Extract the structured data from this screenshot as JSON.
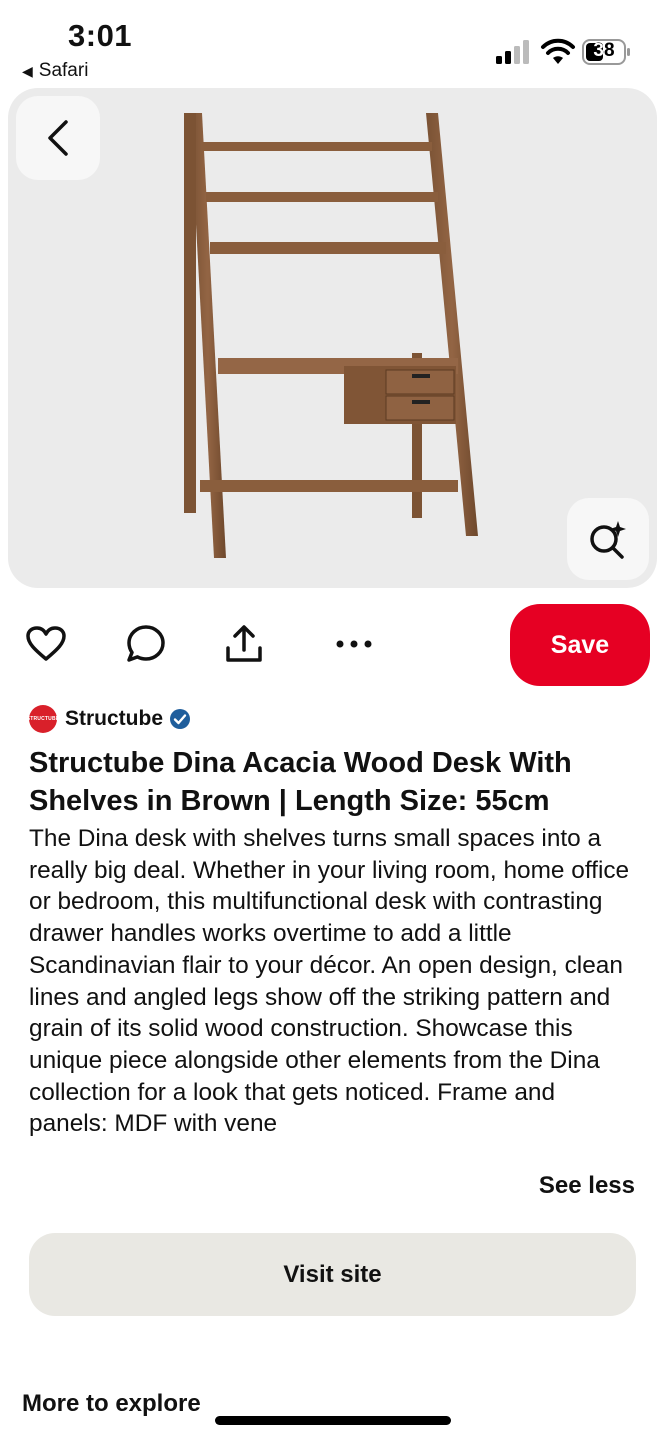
{
  "status_bar": {
    "time": "3:01",
    "back_app": "Safari",
    "battery": "38"
  },
  "hero": {
    "image_subject": "wooden ladder desk with shelves and drawers"
  },
  "actions": {
    "icons": [
      "heart-icon",
      "comment-icon",
      "share-icon",
      "more-icon"
    ],
    "save_label": "Save",
    "save_color": "#e60023"
  },
  "creator": {
    "avatar_text": "STRUCTUBE",
    "name": "Structube",
    "verified": true,
    "verified_color": "#1f5e9c"
  },
  "pin": {
    "title": "Structube Dina Acacia Wood Desk With Shelves in Brown | Length Size:  55cm",
    "description": "The Dina desk with shelves turns small spaces into a really big deal. Whether in your living room, home office or bedroom, this multifunctional desk with contrasting drawer handles works overtime to add a little Scandinavian flair to your décor. An open design, clean lines and angled legs show off the striking pattern and grain of its solid wood construction. Showcase this unique piece alongside other elements from the Dina collection for a look that gets noticed. Frame and panels: MDF with vene",
    "see_less": "See less"
  },
  "visit_site": "Visit site",
  "more_to_explore": "More to explore"
}
